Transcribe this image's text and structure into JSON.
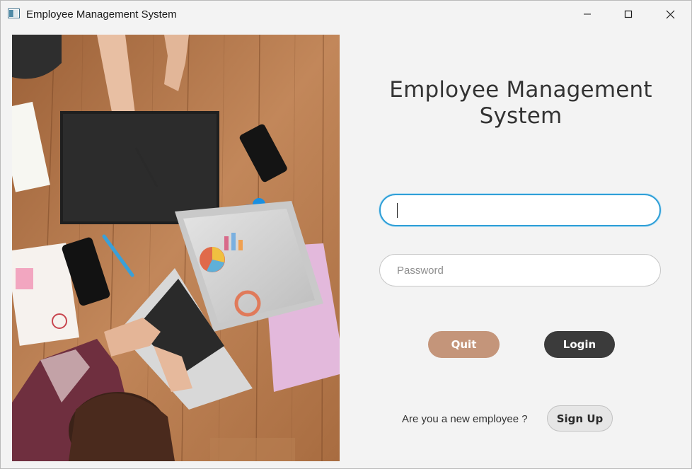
{
  "window": {
    "title": "Employee Management System",
    "controls": [
      "minimize-icon",
      "maximize-icon",
      "close-icon"
    ]
  },
  "photo": {
    "description_icon": "workspace-photo"
  },
  "form": {
    "heading_line1": "Employee Management",
    "heading_line2": "System",
    "username": {
      "value": "",
      "placeholder": ""
    },
    "password": {
      "value": "",
      "placeholder": "Password"
    },
    "quit_label": "Quit",
    "login_label": "Login",
    "new_employee_text": "Are you a new employee ?",
    "signup_label": "Sign Up"
  },
  "colors": {
    "quit": "#c4957a",
    "login": "#3b3b3b",
    "focus": "#2f9fd7"
  }
}
